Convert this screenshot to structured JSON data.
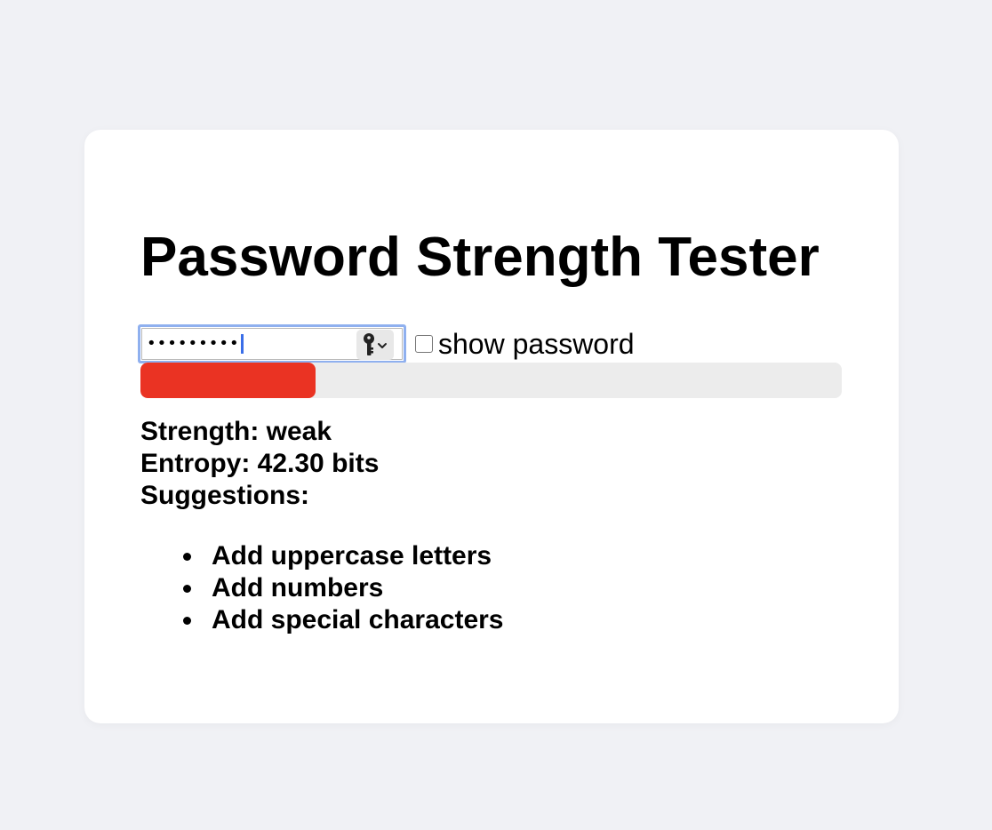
{
  "title": "Password Strength Tester",
  "password_field": {
    "masked_value": "•••••••••"
  },
  "show_password": {
    "label": "show password",
    "checked": false
  },
  "strength_bar": {
    "fill_fraction": 0.25,
    "fill_color": "#ea3323"
  },
  "strength_text": "Strength: weak",
  "entropy_text": "Entropy: 42.30 bits",
  "suggestions_heading": "Suggestions:",
  "suggestions": [
    "Add uppercase letters",
    "Add numbers",
    "Add special characters"
  ]
}
